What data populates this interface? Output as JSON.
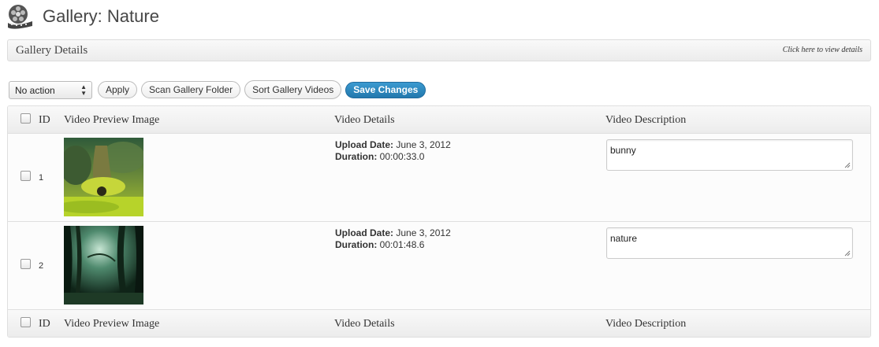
{
  "page": {
    "title": "Gallery: Nature"
  },
  "details": {
    "title": "Gallery Details",
    "toggle_link": "Click here to view details"
  },
  "toolbar": {
    "bulk_action": "No action",
    "apply": "Apply",
    "scan": "Scan Gallery Folder",
    "sort": "Sort Gallery Videos",
    "save": "Save Changes"
  },
  "table": {
    "headers": {
      "id": "ID",
      "preview": "Video Preview Image",
      "details": "Video Details",
      "description": "Video Description"
    },
    "upload_label": "Upload Date:",
    "duration_label": "Duration:",
    "rows": [
      {
        "id": "1",
        "upload_date": "June 3, 2012",
        "duration": "00:00:33.0",
        "description": "bunny"
      },
      {
        "id": "2",
        "upload_date": "June 3, 2012",
        "duration": "00:01:48.6",
        "description": "nature"
      }
    ]
  },
  "colors": {
    "primary_button": "#2a84be",
    "header_bg": "#f1f1f1",
    "border": "#dfdfdf"
  }
}
